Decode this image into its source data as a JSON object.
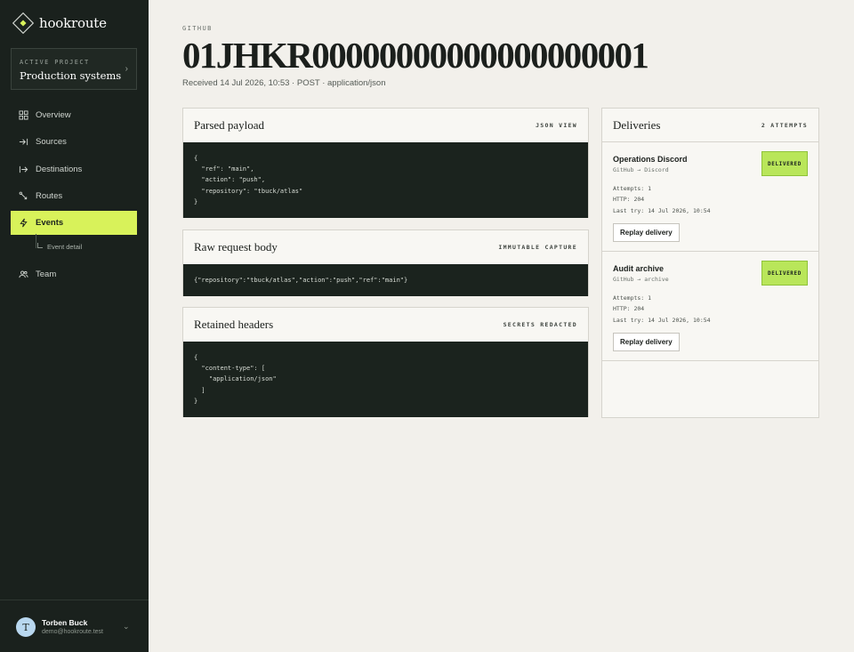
{
  "brand": {
    "name": "hookroute"
  },
  "project": {
    "label": "ACTIVE PROJECT",
    "name": "Production systems"
  },
  "nav": {
    "items": [
      {
        "label": "Overview",
        "icon": "grid-icon"
      },
      {
        "label": "Sources",
        "icon": "arrow-in-icon"
      },
      {
        "label": "Destinations",
        "icon": "arrow-out-icon"
      },
      {
        "label": "Routes",
        "icon": "route-icon"
      },
      {
        "label": "Events",
        "icon": "bolt-icon"
      },
      {
        "label": "Team",
        "icon": "users-icon"
      }
    ],
    "sub_item": "Event detail"
  },
  "user": {
    "initial": "T",
    "name": "Torben Buck",
    "email": "demo@hookroute.test"
  },
  "event": {
    "source": "GITHUB",
    "id": "01JHKR00000000000000000001",
    "meta": "Received 14 Jul 2026, 10:53 · POST · application/json"
  },
  "cards": {
    "payload": {
      "title": "Parsed payload",
      "tag": "JSON VIEW",
      "code": "{\n  \"ref\": \"main\",\n  \"action\": \"push\",\n  \"repository\": \"tbuck/atlas\"\n}"
    },
    "raw": {
      "title": "Raw request body",
      "tag": "IMMUTABLE CAPTURE",
      "code": "{\"repository\":\"tbuck/atlas\",\"action\":\"push\",\"ref\":\"main\"}"
    },
    "headers": {
      "title": "Retained headers",
      "tag": "SECRETS REDACTED",
      "code": "{\n  \"content-type\": [\n    \"application/json\"\n  ]\n}"
    }
  },
  "deliveries": {
    "title": "Deliveries",
    "count": "2 ATTEMPTS",
    "items": [
      {
        "name": "Operations Discord",
        "route": "GitHub → Discord",
        "attempts": "Attempts: 1",
        "http": "HTTP: 204",
        "last_try": "Last try: 14 Jul 2026, 10:54",
        "status": "DELIVERED",
        "action": "Replay delivery"
      },
      {
        "name": "Audit archive",
        "route": "GitHub → archive",
        "attempts": "Attempts: 1",
        "http": "HTTP: 204",
        "last_try": "Last try: 14 Jul 2026, 10:54",
        "status": "DELIVERED",
        "action": "Replay delivery"
      }
    ]
  },
  "colors": {
    "accent": "#d8f25a",
    "sidebar": "#1a211d",
    "delivered": "#b9e65a"
  }
}
